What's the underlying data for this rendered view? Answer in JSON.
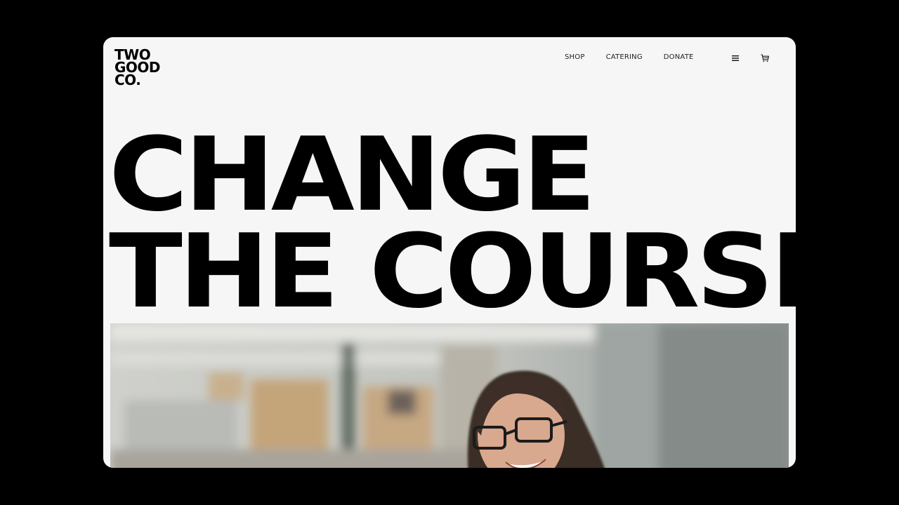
{
  "brand": {
    "logo_lines": [
      "TWO",
      "GOOD",
      "CO."
    ]
  },
  "nav": {
    "items": [
      "SHOP",
      "CATERING",
      "DONATE"
    ]
  },
  "icons": {
    "menu": "hamburger-menu-icon",
    "cart": "shopping-cart-icon"
  },
  "hero": {
    "title_lines": [
      "CHANGE",
      "THE COURSE"
    ],
    "image_description": "photo-woman-with-glasses-smiling"
  },
  "colors": {
    "page_background": "#000000",
    "card_background": "#f6f6f6",
    "text": "#000000"
  }
}
